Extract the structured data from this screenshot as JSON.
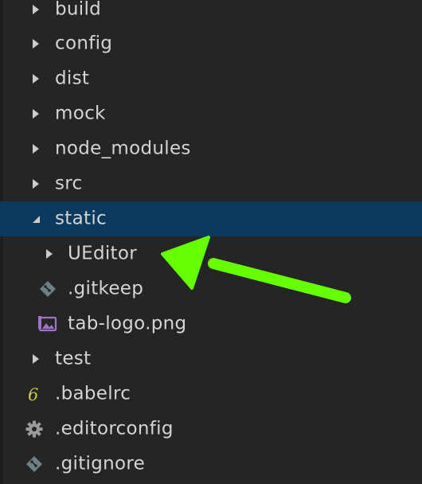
{
  "explorer": {
    "items": [
      {
        "label": "build",
        "kind": "folder",
        "state": "collapsed"
      },
      {
        "label": "config",
        "kind": "folder",
        "state": "collapsed"
      },
      {
        "label": "dist",
        "kind": "folder",
        "state": "collapsed"
      },
      {
        "label": "mock",
        "kind": "folder",
        "state": "collapsed"
      },
      {
        "label": "node_modules",
        "kind": "folder",
        "state": "collapsed"
      },
      {
        "label": "src",
        "kind": "folder",
        "state": "collapsed"
      },
      {
        "label": "static",
        "kind": "folder",
        "state": "expanded",
        "selected": true
      },
      {
        "label": "UEditor",
        "kind": "folder",
        "state": "collapsed",
        "parent": "static"
      },
      {
        "label": ".gitkeep",
        "kind": "file",
        "icon": "git-icon",
        "parent": "static"
      },
      {
        "label": "tab-logo.png",
        "kind": "file",
        "icon": "image-icon",
        "parent": "static"
      },
      {
        "label": "test",
        "kind": "folder",
        "state": "collapsed"
      },
      {
        "label": ".babelrc",
        "kind": "file",
        "icon": "babel-icon"
      },
      {
        "label": ".editorconfig",
        "kind": "file",
        "icon": "gear-icon"
      },
      {
        "label": ".gitignore",
        "kind": "file",
        "icon": "git-icon"
      }
    ]
  },
  "colors": {
    "background": "#252526",
    "selected_row": "#0b3a5e",
    "annotation_arrow": "#66ff00",
    "image_icon": "#a074c4",
    "babel_icon": "#cbcb41",
    "git_icon": "#6d8086",
    "gear_icon": "#9a9a9a"
  }
}
